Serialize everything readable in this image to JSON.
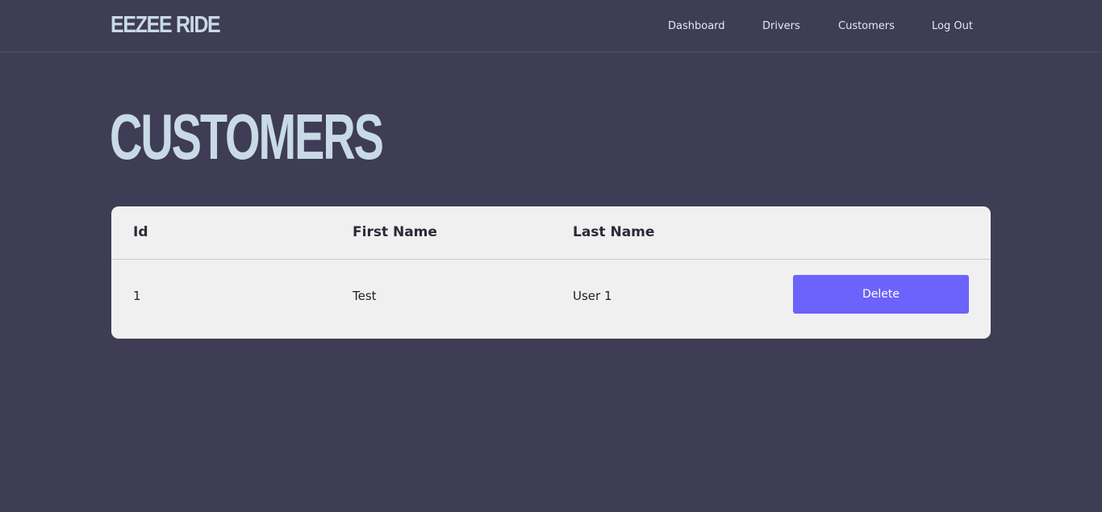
{
  "header": {
    "brand": "EEZEE RIDE",
    "nav": [
      {
        "label": "Dashboard"
      },
      {
        "label": "Drivers"
      },
      {
        "label": "Customers"
      },
      {
        "label": "Log Out"
      }
    ]
  },
  "main": {
    "title": "CUSTOMERS",
    "table": {
      "columns": [
        "Id",
        "First Name",
        "Last Name"
      ],
      "rows": [
        {
          "id": "1",
          "first_name": "Test",
          "last_name": "User 1",
          "action_label": "Delete"
        }
      ]
    }
  },
  "colors": {
    "background": "#3f3c55",
    "brand": "#c8dae6",
    "card": "#f0f0f0",
    "accent": "#6b63fb"
  }
}
